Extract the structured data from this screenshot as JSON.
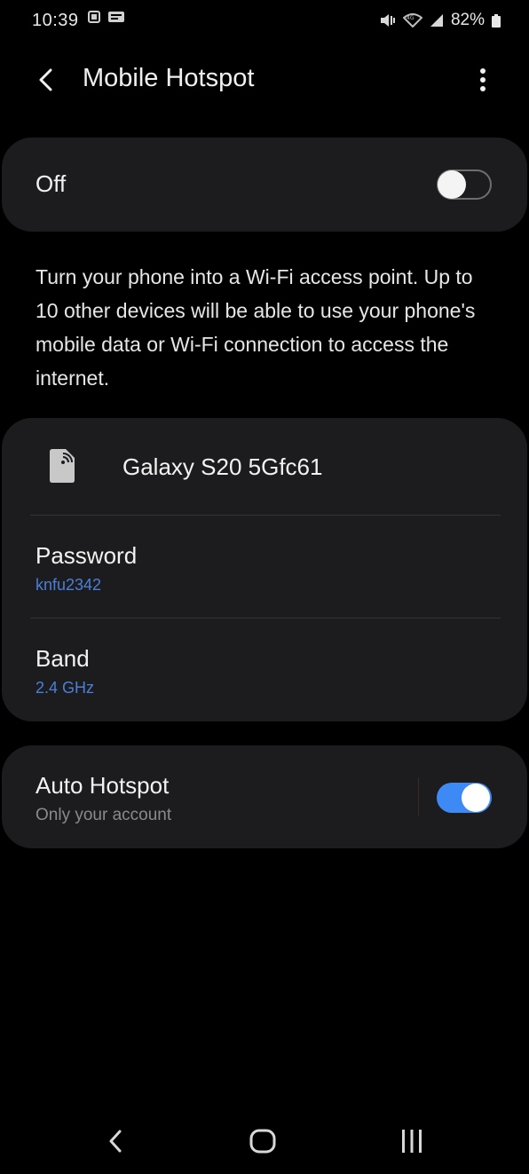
{
  "status_bar": {
    "time": "10:39",
    "battery_percent": "82%"
  },
  "header": {
    "title": "Mobile Hotspot"
  },
  "master_switch": {
    "label": "Off",
    "enabled": false
  },
  "description": "Turn your phone into a Wi-Fi access point. Up to 10 other devices will be able to use your phone's mobile data or Wi-Fi connection to access the internet.",
  "network": {
    "name": "Galaxy S20 5Gfc61",
    "icon": "hotspot-icon"
  },
  "password": {
    "label": "Password",
    "value": "knfu2342"
  },
  "band": {
    "label": "Band",
    "value": "2.4 GHz"
  },
  "auto_hotspot": {
    "label": "Auto Hotspot",
    "subtitle": "Only your account",
    "enabled": true
  },
  "colors": {
    "accent": "#3e8af5",
    "value_text": "#4a7fd9",
    "card_bg": "#1c1c1e",
    "background": "#000000"
  }
}
